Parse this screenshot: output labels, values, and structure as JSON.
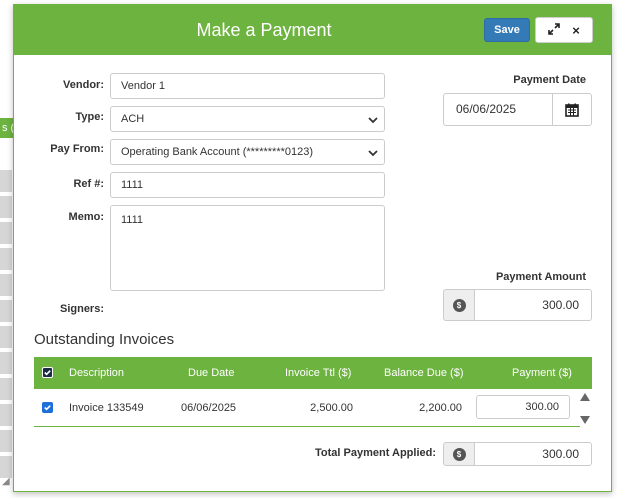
{
  "background": {
    "tab_fragment": "s (",
    "row_tops": [
      170,
      196,
      222,
      248,
      274,
      300,
      326,
      352,
      378,
      404,
      430,
      456
    ]
  },
  "modal": {
    "title": "Make a Payment",
    "save_label": "Save",
    "expand_icon": "expand-icon",
    "close_label": "×"
  },
  "form": {
    "vendor_label": "Vendor:",
    "vendor_value": "Vendor 1",
    "type_label": "Type:",
    "type_value": "ACH",
    "pay_from_label": "Pay From:",
    "pay_from_value": "Operating Bank Account (*********0123)",
    "ref_label": "Ref #:",
    "ref_value": "1111",
    "memo_label": "Memo:",
    "memo_value": "1111",
    "signers_label": "Signers:",
    "payment_date_label": "Payment Date",
    "payment_date_value": "06/06/2025",
    "payment_amount_label": "Payment Amount",
    "payment_amount_value": "300.00",
    "dollar_symbol": "$"
  },
  "invoices": {
    "section_title": "Outstanding Invoices",
    "columns": [
      "Description",
      "Due Date",
      "Invoice Ttl ($)",
      "Balance Due ($)",
      "Payment ($)"
    ],
    "rows": [
      {
        "checked": true,
        "description": "Invoice 133549",
        "due_date": "06/06/2025",
        "invoice_total": "2,500.00",
        "balance_due": "2,200.00",
        "payment": "300.00"
      }
    ],
    "total_label": "Total Payment Applied:",
    "total_value": "300.00"
  },
  "colors": {
    "brand_green": "#6db33f",
    "save_blue": "#337ab7",
    "checkbox_blue": "#1e6fd9"
  }
}
